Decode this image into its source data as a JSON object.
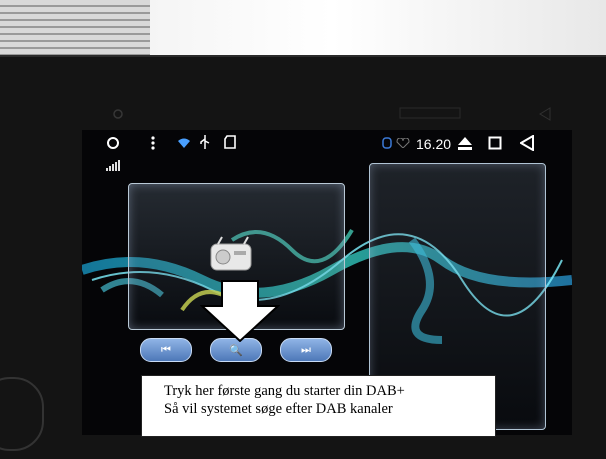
{
  "status_bar": {
    "time": "16.20",
    "icons": [
      "circle-icon",
      "more-vert-icon",
      "wifi-icon",
      "usb-icon",
      "sd-card-icon",
      "notification-icon",
      "heart-icon",
      "eject-icon",
      "recents-square-icon",
      "back-triangle-icon",
      "signal-bars-icon"
    ]
  },
  "radio": {
    "source_icon": "radio-device-icon",
    "controls": {
      "prev_label": "⏮",
      "search_label": "🔍",
      "next_label": "⏭"
    }
  },
  "annotation": {
    "line1": "Tryk her første gang du starter din DAB+",
    "line2": "Så vil systemet søge efter DAB kanaler"
  },
  "colors": {
    "button_blue": "#5b84c2",
    "smoke_cyan": "#35e0d0",
    "smoke_yellow": "#d8e24a"
  }
}
